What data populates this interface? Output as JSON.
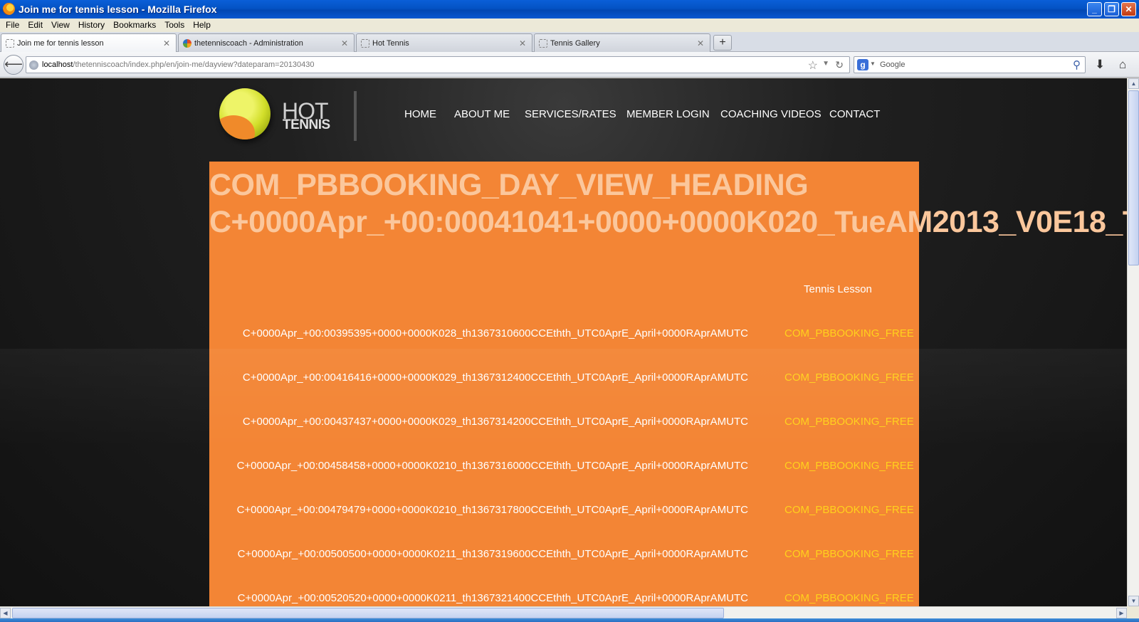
{
  "window": {
    "title": "Join me for tennis lesson - Mozilla Firefox",
    "controls": [
      "_",
      "❐",
      "✕"
    ]
  },
  "menubar": {
    "items": [
      "File",
      "Edit",
      "View",
      "History",
      "Bookmarks",
      "Tools",
      "Help"
    ]
  },
  "tabs": [
    {
      "label": "Join me for tennis lesson",
      "active": true
    },
    {
      "label": "thetenniscoach - Administration",
      "active": false
    },
    {
      "label": "Hot Tennis",
      "active": false
    },
    {
      "label": "Tennis Gallery",
      "active": false
    }
  ],
  "navbar": {
    "url_host": "localhost",
    "url_path": "/thetenniscoach/index.php/en/join-me/dayview?dateparam=20130430",
    "search_placeholder": "Google",
    "search_engine_letter": "g"
  },
  "site": {
    "logo_hot": "HOT",
    "logo_tennis": "TENNIS",
    "nav": [
      "HOME",
      "ABOUT ME",
      "SERVICES/RATES",
      "MEMBER LOGIN",
      "COACHING VIDEOS",
      "CONTACT"
    ]
  },
  "booking": {
    "heading_line1": "COM_PBBOOKING_DAY_VIEW_HEADING",
    "heading_line2": "C+0000Apr_+00:00041041+0000+0000K020_TueAM2013_V0E18_T",
    "column_header": "Tennis Lesson",
    "slots": [
      {
        "time": "C+0000Apr_+00:00395395+0000+0000K028_th1367310600CCEthth_UTC0AprE_April+0000RAprAMUTC",
        "status": "COM_PBBOOKING_FREE"
      },
      {
        "time": "C+0000Apr_+00:00416416+0000+0000K029_th1367312400CCEthth_UTC0AprE_April+0000RAprAMUTC",
        "status": "COM_PBBOOKING_FREE"
      },
      {
        "time": "C+0000Apr_+00:00437437+0000+0000K029_th1367314200CCEthth_UTC0AprE_April+0000RAprAMUTC",
        "status": "COM_PBBOOKING_FREE"
      },
      {
        "time": "C+0000Apr_+00:00458458+0000+0000K0210_th1367316000CCEthth_UTC0AprE_April+0000RAprAMUTC",
        "status": "COM_PBBOOKING_FREE"
      },
      {
        "time": "C+0000Apr_+00:00479479+0000+0000K0210_th1367317800CCEthth_UTC0AprE_April+0000RAprAMUTC",
        "status": "COM_PBBOOKING_FREE"
      },
      {
        "time": "C+0000Apr_+00:00500500+0000+0000K0211_th1367319600CCEthth_UTC0AprE_April+0000RAprAMUTC",
        "status": "COM_PBBOOKING_FREE"
      },
      {
        "time": "C+0000Apr_+00:00520520+0000+0000K0211_th1367321400CCEthth_UTC0AprE_April+0000RAprAMUTC",
        "status": "COM_PBBOOKING_FREE"
      }
    ]
  },
  "colors": {
    "panel": "#f38535",
    "heading": "#fbc79c",
    "free_status": "#ffd21c",
    "page_bg": "#1a1a1a"
  }
}
